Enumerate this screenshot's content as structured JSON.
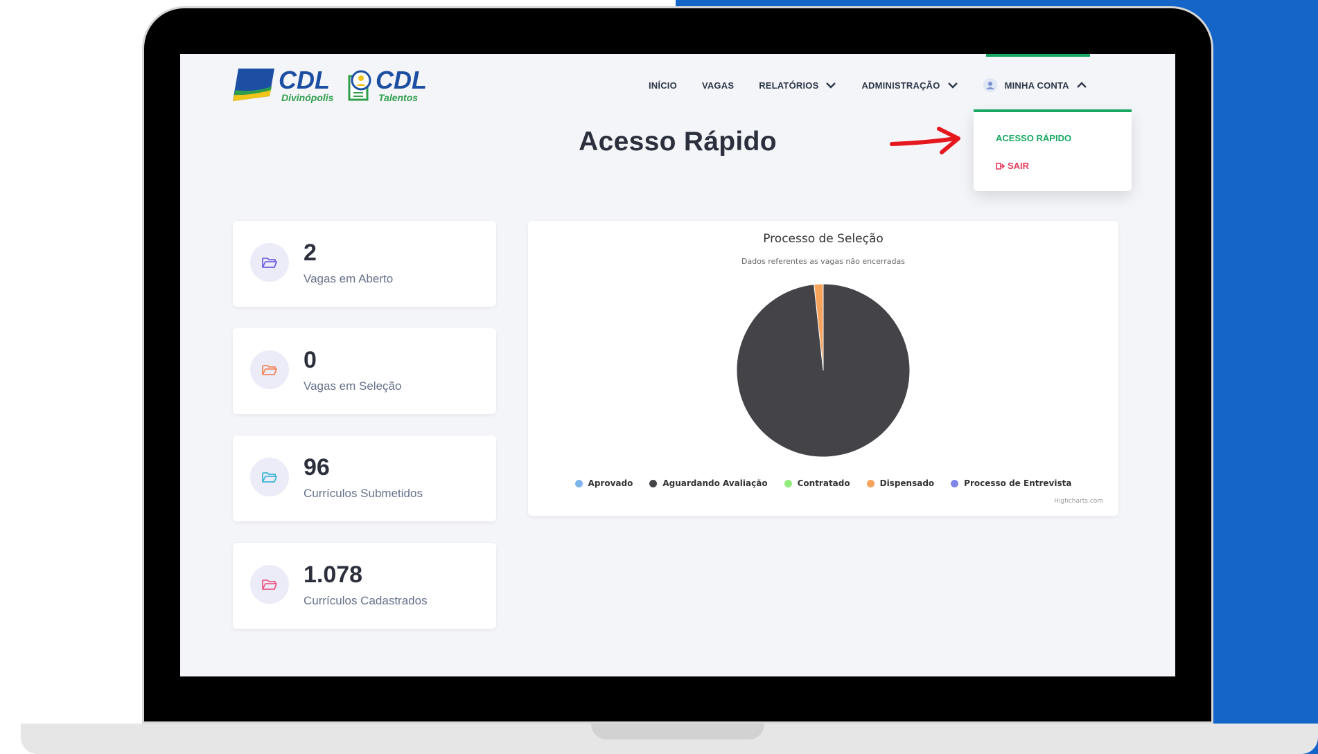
{
  "brand": {
    "logo1_text": "CDL",
    "logo1_sub": "Divinópolis",
    "logo2_text": "CDL",
    "logo2_sub": "Talentos"
  },
  "nav": {
    "items": [
      {
        "label": "INÍCIO"
      },
      {
        "label": "VAGAS"
      },
      {
        "label": "RELATÓRIOS"
      },
      {
        "label": "ADMINISTRAÇÃO"
      }
    ],
    "account_label": "MINHA CONTA"
  },
  "dropdown": {
    "items": [
      {
        "label": "ACESSO RÁPIDO"
      },
      {
        "label": "SAIR"
      }
    ]
  },
  "page": {
    "title": "Acesso Rápido"
  },
  "stats": [
    {
      "value": "2",
      "label": "Vagas em Aberto",
      "icon": "folder-open-icon",
      "color": "#6e64e0"
    },
    {
      "value": "0",
      "label": "Vagas em Seleção",
      "icon": "folder-open-icon",
      "color": "#f2875c"
    },
    {
      "value": "96",
      "label": "Currículos Submetidos",
      "icon": "folder-open-icon",
      "color": "#3fb6d8"
    },
    {
      "value": "1.078",
      "label": "Currículos Cadastrados",
      "icon": "folder-open-icon",
      "color": "#ec5b86"
    }
  ],
  "chart": {
    "title": "Processo de Seleção",
    "subtitle": "Dados referentes as vagas não encerradas",
    "credits": "Highcharts.com"
  },
  "chart_data": {
    "type": "pie",
    "title": "Processo de Seleção",
    "subtitle": "Dados referentes as vagas não encerradas",
    "series": [
      {
        "name": "Aprovado",
        "value": 0,
        "color": "#7cb5ec"
      },
      {
        "name": "Aguardando Avaliação",
        "value": 98.3,
        "color": "#434348"
      },
      {
        "name": "Contratado",
        "value": 0,
        "color": "#90ed7d"
      },
      {
        "name": "Dispensado",
        "value": 1.7,
        "color": "#f7a35c"
      },
      {
        "name": "Processo de Entrevista",
        "value": 0,
        "color": "#8085e9"
      }
    ],
    "legend_position": "bottom"
  },
  "colors": {
    "accent": "#19a862",
    "danger": "#e53a5c",
    "text_dark": "#2b303c"
  }
}
